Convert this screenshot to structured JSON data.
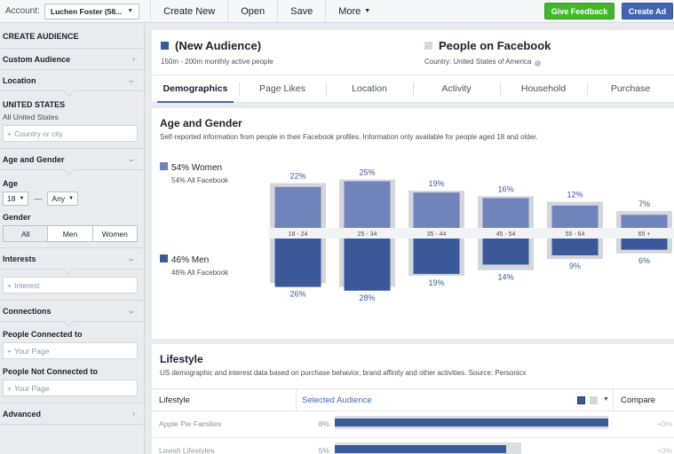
{
  "topbar": {
    "account_label": "Account:",
    "account_value": "Luchen Foster (58...",
    "menu": [
      {
        "label": "Create New"
      },
      {
        "label": "Open"
      },
      {
        "label": "Save"
      },
      {
        "label": "More"
      }
    ],
    "feedback_label": "Give Feedback",
    "create_ad_label": "Create Ad"
  },
  "sidebar": {
    "heading": "CREATE AUDIENCE",
    "custom_audience": "Custom Audience",
    "location": "Location",
    "country_heading": "UNITED STATES",
    "country_sub": "All United States",
    "country_placeholder": "Country or city",
    "age_gender": "Age and Gender",
    "age_label": "Age",
    "age_min": "18",
    "age_max": "Any",
    "gender_label": "Gender",
    "gender_options": [
      "All",
      "Men",
      "Women"
    ],
    "interests": "Interests",
    "interest_placeholder": "Interest",
    "connections": "Connections",
    "people_connected": "People Connected to",
    "your_page_placeholder": "Your Page",
    "people_not_connected": "People Not Connected to",
    "your_page_placeholder_2": "Your Page",
    "advanced": "Advanced"
  },
  "audience": {
    "title": "(New Audience)",
    "subtitle": "150m - 200m monthly active people",
    "compare_title": "People on Facebook",
    "compare_subtitle": "Country: United States of America",
    "selected_color": "#3b5998",
    "compare_color": "#d3d6db"
  },
  "tabs": [
    {
      "label": "Demographics",
      "active": true
    },
    {
      "label": "Page Likes"
    },
    {
      "label": "Location"
    },
    {
      "label": "Activity"
    },
    {
      "label": "Household"
    },
    {
      "label": "Purchase"
    }
  ],
  "age_gender_section": {
    "title": "Age and Gender",
    "description": "Self-reported information from people in their Facebook profiles. Information only available for people aged 18 and older.",
    "women_label": "54% Women",
    "women_sub": "54% All Facebook",
    "men_label": "46% Men",
    "men_sub": "46% All Facebook"
  },
  "chart_data": {
    "type": "bar",
    "categories": [
      "18 - 24",
      "25 - 34",
      "35 - 44",
      "45 - 54",
      "55 - 64",
      "65 +"
    ],
    "series": [
      {
        "name": "54% Women",
        "values": [
          22,
          25,
          19,
          16,
          12,
          7
        ],
        "baseline": [
          24,
          26,
          20,
          17,
          14,
          9
        ],
        "color": "#7083bb"
      },
      {
        "name": "46% Men",
        "values": [
          26,
          28,
          19,
          14,
          9,
          6
        ],
        "baseline": [
          24,
          26,
          20,
          17,
          11,
          8
        ],
        "color": "#3b5998"
      }
    ],
    "baseline_color": "#d3d6db",
    "value_labels": [
      "22%",
      "25%",
      "19%",
      "16%",
      "12%",
      "7%",
      "26%",
      "28%",
      "19%",
      "14%",
      "9%",
      "6%"
    ],
    "ylim": [
      0,
      30
    ]
  },
  "lifestyle": {
    "title": "Lifestyle",
    "description": "US demographic and interest data based on purchase behavior, brand affinity and other activities. Source: Personicx",
    "col_lifestyle": "Lifestyle",
    "col_selected": "Selected Audience",
    "col_compare": "Compare",
    "rows": [
      {
        "label": "Apple Pie Families",
        "pct": "8%",
        "value": 8,
        "compare": "+0%"
      },
      {
        "label": "Lavish Lifestyles",
        "pct": "5%",
        "value": 5,
        "compare": "+0%"
      }
    ]
  }
}
